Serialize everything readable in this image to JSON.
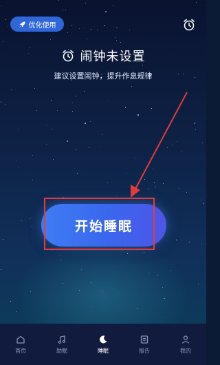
{
  "header": {
    "optimize_label": "优化使用"
  },
  "main": {
    "title": "闹钟未设置",
    "subtitle": "建议设置闹钟，提升作息规律",
    "start_button_label": "开始睡眠"
  },
  "tabs": [
    {
      "label": "首页",
      "icon": "home-icon",
      "active": false
    },
    {
      "label": "助眠",
      "icon": "music-icon",
      "active": false
    },
    {
      "label": "睡眠",
      "icon": "moon-icon",
      "active": true
    },
    {
      "label": "报告",
      "icon": "report-icon",
      "active": false
    },
    {
      "label": "我的",
      "icon": "person-icon",
      "active": false
    }
  ],
  "colors": {
    "accent": "#3968ef",
    "highlight": "#e43b3b",
    "tabbar": "#101b3e"
  }
}
